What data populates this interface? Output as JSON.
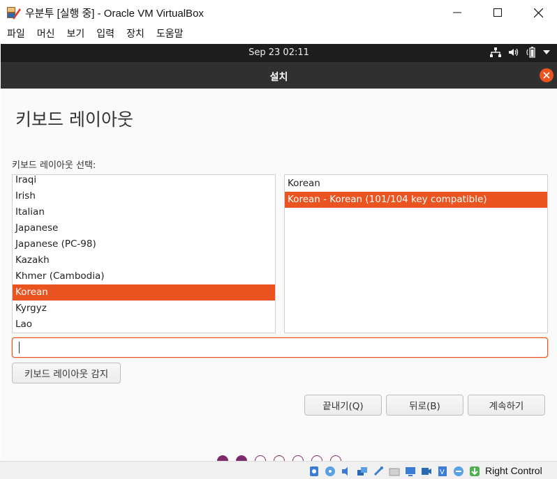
{
  "window": {
    "title": "우분투 [실행 중] - Oracle VM VirtualBox"
  },
  "menubar": {
    "items": [
      "파일",
      "머신",
      "보기",
      "입력",
      "장치",
      "도움말"
    ]
  },
  "topbar": {
    "clock": "Sep 23  02:11"
  },
  "installer": {
    "header_title": "설치",
    "page_title": "키보드 레이아웃",
    "list_label": "키보드 레이아웃 선택:",
    "layouts": [
      "Iraqi",
      "Irish",
      "Italian",
      "Japanese",
      "Japanese (PC-98)",
      "Kazakh",
      "Khmer (Cambodia)",
      "Korean",
      "Kyrgyz",
      "Lao"
    ],
    "selected_layout": "Korean",
    "variants": [
      "Korean",
      "Korean - Korean (101/104 key compatible)"
    ],
    "selected_variant": "Korean - Korean (101/104 key compatible)",
    "test_input_value": "",
    "detect_button": "키보드 레이아웃 감지",
    "quit_button": "끝내기(Q)",
    "back_button": "뒤로(B)",
    "continue_button": "계속하기",
    "progress": {
      "total_steps": 7,
      "completed_steps": 2
    }
  },
  "statusbar": {
    "host_key": "Right Control"
  },
  "colors": {
    "accent": "#e95420",
    "header_bg": "#303030",
    "topbar_bg": "#1d1d1d",
    "progress_dot": "#7e2b6e"
  }
}
